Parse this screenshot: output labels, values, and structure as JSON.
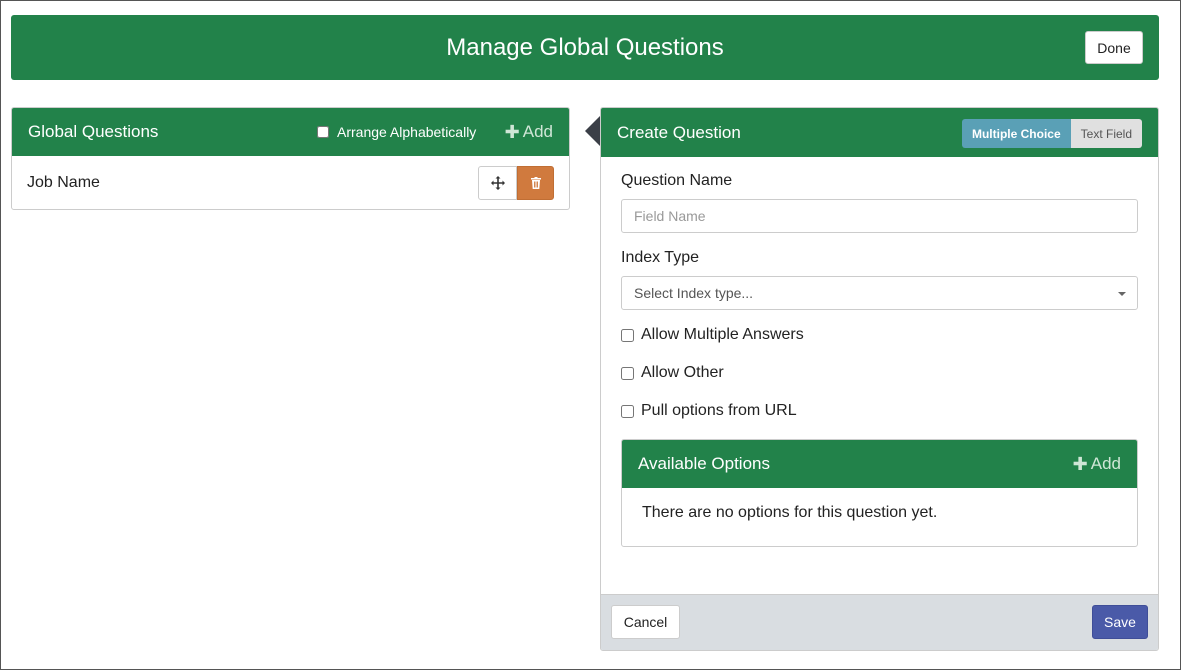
{
  "header": {
    "title": "Manage Global Questions",
    "done_label": "Done"
  },
  "global_questions": {
    "title": "Global Questions",
    "arrange_label": "Arrange Alphabetically",
    "add_label": "Add",
    "items": [
      {
        "label": "Job Name"
      }
    ]
  },
  "create_question": {
    "title": "Create Question",
    "type_options": [
      "Multiple Choice",
      "Text Field"
    ],
    "selected_type": "Multiple Choice",
    "question_name_label": "Question Name",
    "question_name_placeholder": "Field Name",
    "question_name_value": "",
    "index_type_label": "Index Type",
    "index_type_value": "Select Index type...",
    "checkboxes": [
      {
        "label": "Allow Multiple Answers",
        "checked": false
      },
      {
        "label": "Allow Other",
        "checked": false
      },
      {
        "label": "Pull options from URL",
        "checked": false
      }
    ],
    "available_options": {
      "title": "Available Options",
      "add_label": "Add",
      "empty_text": "There are no options for this question yet."
    },
    "cancel_label": "Cancel",
    "save_label": "Save"
  },
  "colors": {
    "primary_green": "#22824a",
    "delete_orange": "#d07a3e",
    "toggle_active": "#5aa0b6",
    "save_blue": "#4a5aa8"
  },
  "icons": {
    "move": "move-icon",
    "delete": "trash-icon",
    "add": "plus-icon"
  }
}
